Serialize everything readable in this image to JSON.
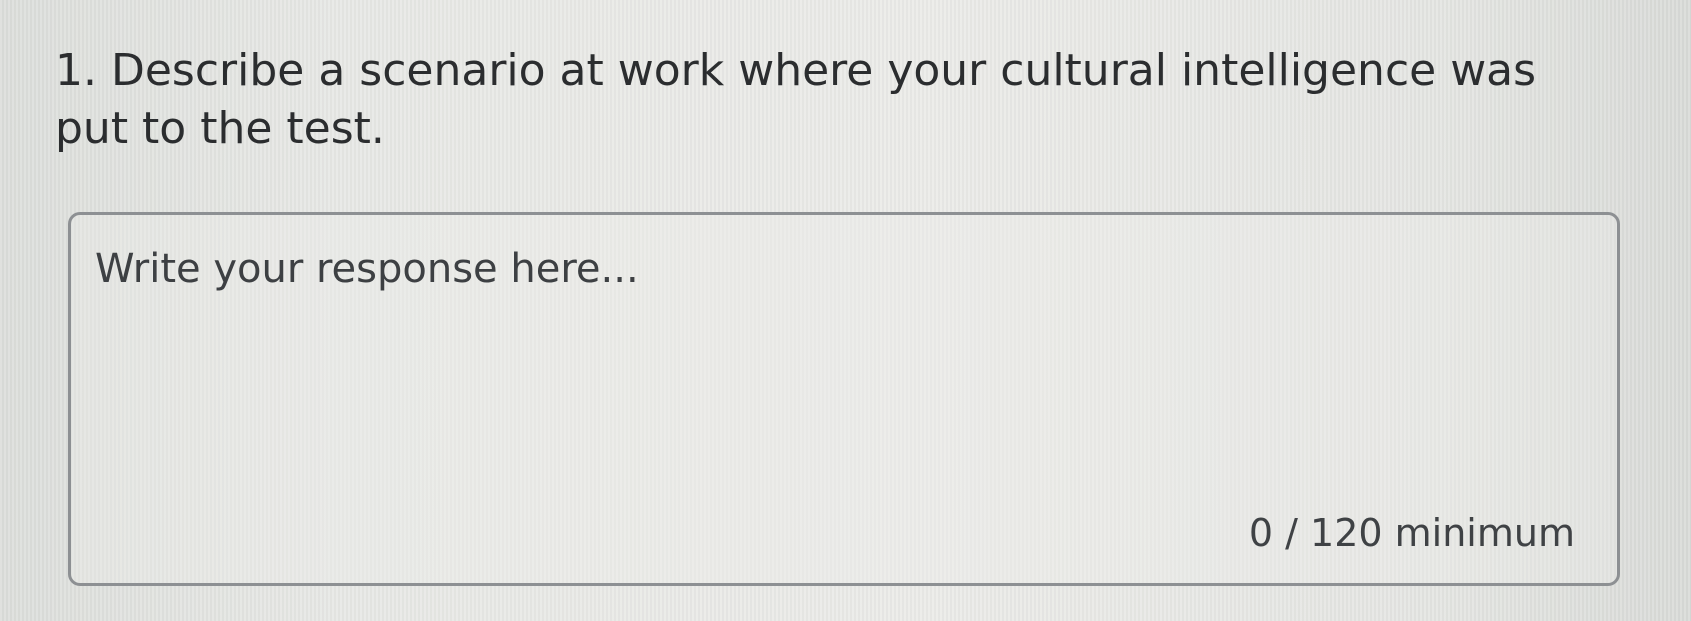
{
  "question": {
    "text": "1. Describe a scenario at work where your cultural intelligence was put to the test."
  },
  "response": {
    "value": "",
    "placeholder": "Write your response here...",
    "counter_text": "0 / 120 minimum"
  }
}
